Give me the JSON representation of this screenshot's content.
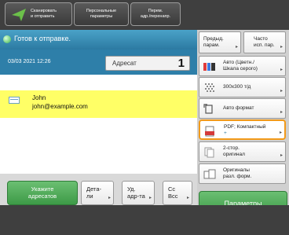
{
  "topbar": {
    "scan_send": {
      "line1": "Сканировать",
      "line2": "и отправить"
    },
    "personal_options": {
      "line1": "Персональные",
      "line2": "параметры"
    },
    "onetouch": {
      "line1": "Перем.",
      "line2": "адр./перенапр."
    }
  },
  "status": {
    "text": "Готов к отправке."
  },
  "datetime": "03/03 2021 12:26",
  "destination": {
    "label": "Адресат",
    "count": "1"
  },
  "contacts": [
    {
      "name": "John",
      "email": "john@example.com"
    }
  ],
  "bottom_buttons": {
    "specify": {
      "line1": "Укажите",
      "line2": "адресатов"
    },
    "details": {
      "line1": "Дета-",
      "line2": "ли"
    },
    "delete": {
      "line1": "Уд.",
      "line2": "адр-та"
    },
    "cc_bcc": {
      "line1": "Cc",
      "line2": "Bcc"
    }
  },
  "settings": {
    "prev_settings": {
      "line1": "Предыд.",
      "line2": "парам."
    },
    "frequent": {
      "line1": "Часто",
      "line2": "исп. пар."
    },
    "color": {
      "line1": "Авто (Цветн./",
      "line2": "Шкала серого)"
    },
    "resolution": {
      "line1": "300x300 т/д"
    },
    "original_size": {
      "line1": "Авто формат"
    },
    "file_format": {
      "line1": "PDF; Компактный",
      "line2": "+"
    },
    "duplex": {
      "line1": "2-стор.",
      "line2": "оригинал"
    },
    "mixed": {
      "line1": "Оригиналы",
      "line2": "разл. форм."
    },
    "parameters": "Параметры"
  },
  "colors": {
    "accent_green": "#3d9a47",
    "status_blue": "#2e7fa9",
    "selection_yellow": "#ffff66",
    "highlight_orange": "#f29a1a"
  }
}
